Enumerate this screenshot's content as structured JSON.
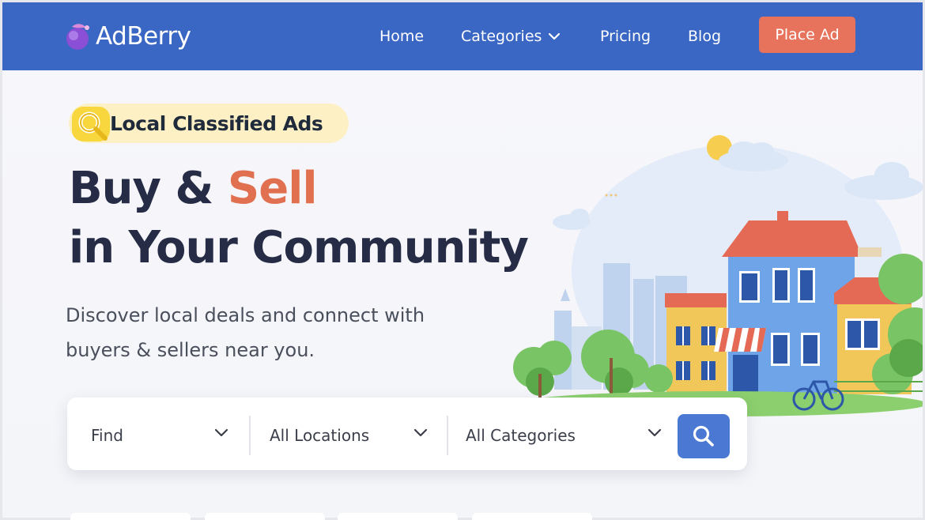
{
  "header": {
    "logo_text": "AdBerry",
    "nav": {
      "home": "Home",
      "categories": "Categories",
      "pricing": "Pricing",
      "blog": "Blog"
    },
    "cta_label": "Place Ad"
  },
  "hero": {
    "badge_text": "Local Classified Ads",
    "headline_line1_part1": "Buy & ",
    "headline_line1_accent": "Sell",
    "headline_line2": "in Your Community",
    "subheading": "Discover local deals and connect with buyers & sellers near you."
  },
  "search": {
    "find_value": "Find",
    "location_value": "All Locations",
    "category_value": "All Categories"
  },
  "colors": {
    "header_bg": "#3a66c4",
    "cta_bg": "#e8735c",
    "accent_text": "#e0704f",
    "badge_bg": "#fcf0c4",
    "search_button_bg": "#4a78d2",
    "headline_text": "#262c45"
  },
  "icons": [
    "berry-logo-icon",
    "chevron-down-icon",
    "search-icon",
    "magnifier-badge-icon"
  ]
}
